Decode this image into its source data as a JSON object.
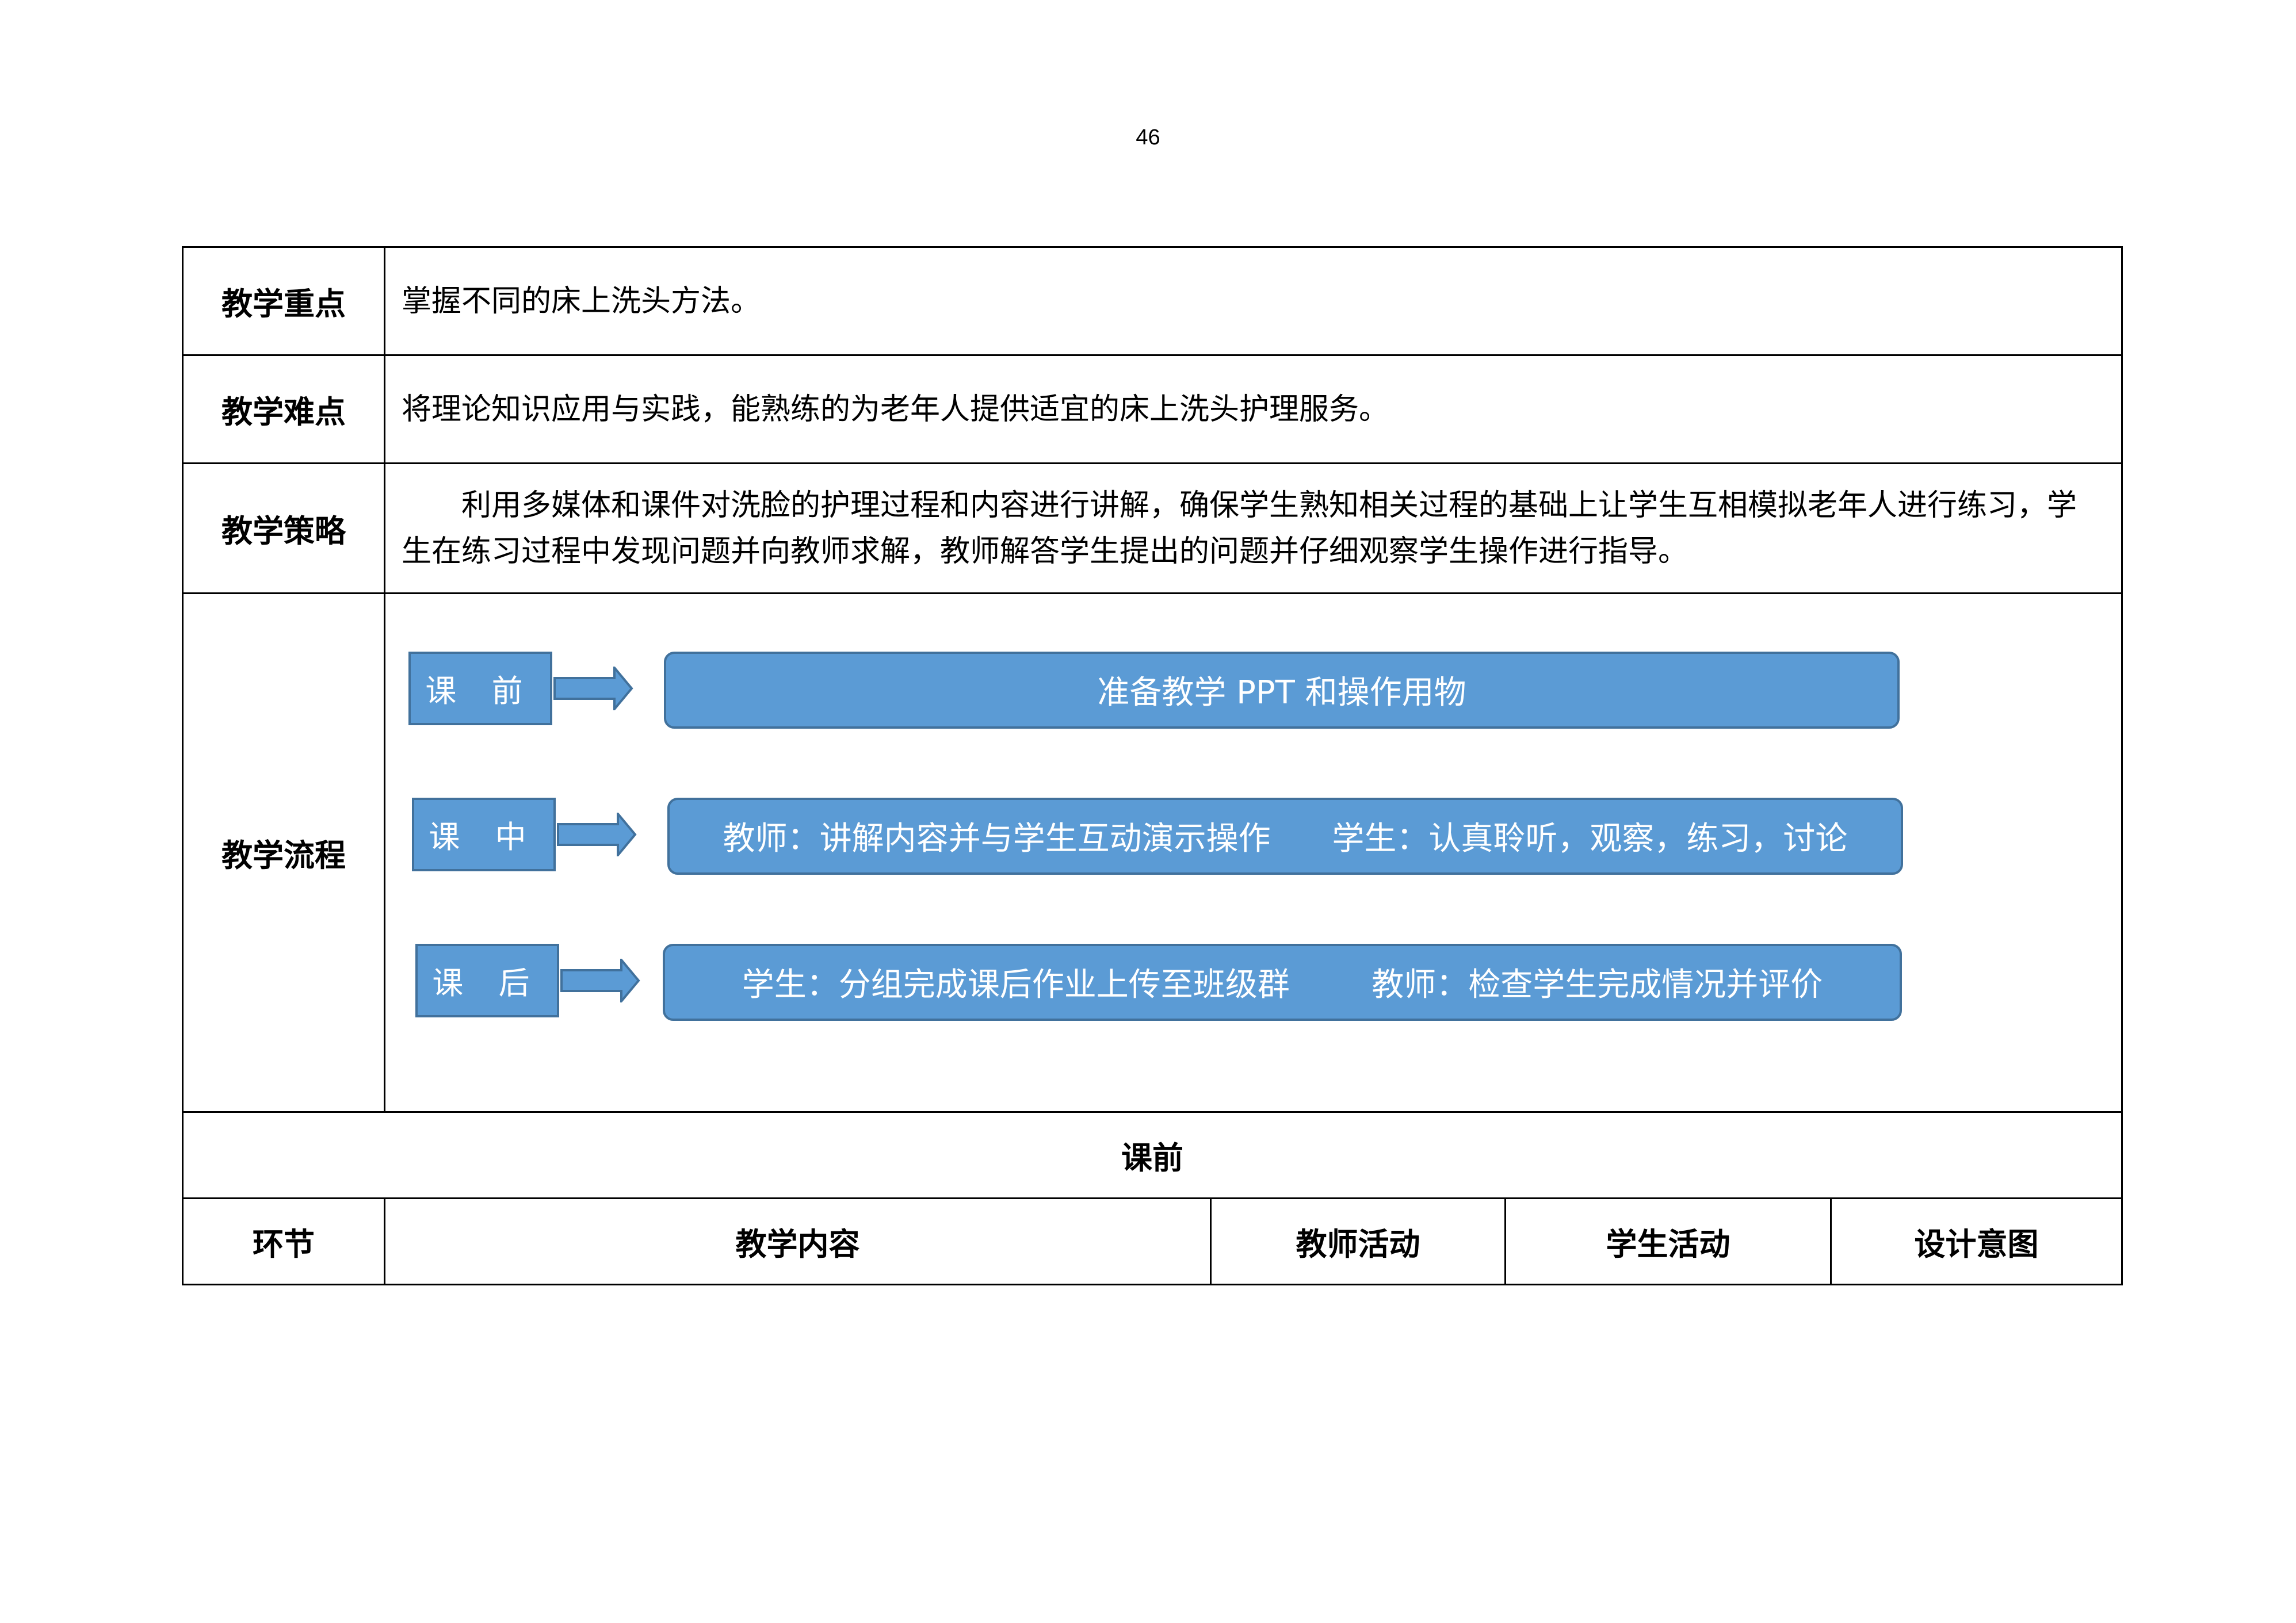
{
  "page_number": "46",
  "rows": {
    "key_point": {
      "label": "教学重点",
      "content": "掌握不同的床上洗头方法。"
    },
    "difficulty": {
      "label": "教学难点",
      "content": "将理论知识应用与实践，能熟练的为老年人提供适宜的床上洗头护理服务。"
    },
    "strategy": {
      "label": "教学策略",
      "content": "利用多媒体和课件对洗脸的护理过程和内容进行讲解，确保学生熟知相关过程的基础上让学生互相模拟老年人进行练习，学生在练习过程中发现问题并向教师求解，教师解答学生提出的问题并仔细观察学生操作进行指导。"
    },
    "flow": {
      "label": "教学流程",
      "stages": [
        {
          "stage": "课 前",
          "content": "准备教学 PPT 和操作用物"
        },
        {
          "stage": "课 中",
          "content": "教师：讲解内容并与学生互动演示操作      学生：认真聆听，观察，练习，讨论"
        },
        {
          "stage": "课 后",
          "content": "学生：分组完成课后作业上传至班级群        教师：检查学生完成情况并评价"
        }
      ]
    }
  },
  "section_title": "课前",
  "columns": [
    "环节",
    "教学内容",
    "教师活动",
    "学生活动",
    "设计意图"
  ]
}
